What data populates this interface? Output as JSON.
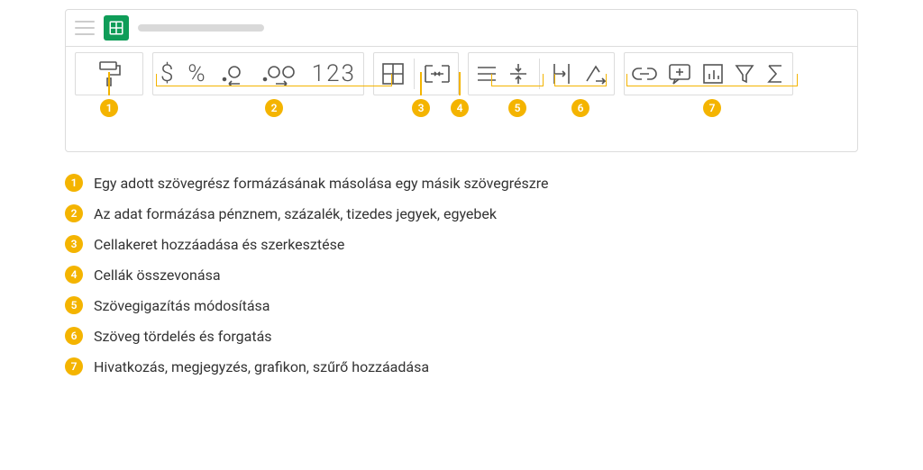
{
  "toolbar": {
    "numberFormat": "123"
  },
  "legend": [
    {
      "n": "1",
      "text": "Egy adott szövegrész formázásának másolása egy másik szövegrészre"
    },
    {
      "n": "2",
      "text": "Az adat formázása pénznem, százalék, tizedes jegyek, egyebek"
    },
    {
      "n": "3",
      "text": "Cellakeret hozzáadása és szerkesztése"
    },
    {
      "n": "4",
      "text": "Cellák összevonása"
    },
    {
      "n": "5",
      "text": "Szövegigazítás módosítása"
    },
    {
      "n": "6",
      "text": "Szöveg tördelés és forgatás"
    },
    {
      "n": "7",
      "text": "Hivatkozás, megjegyzés, grafikon, szűrő hozzáadása"
    }
  ],
  "colors": {
    "accent": "#f4b400",
    "sheets": "#0f9d58"
  }
}
